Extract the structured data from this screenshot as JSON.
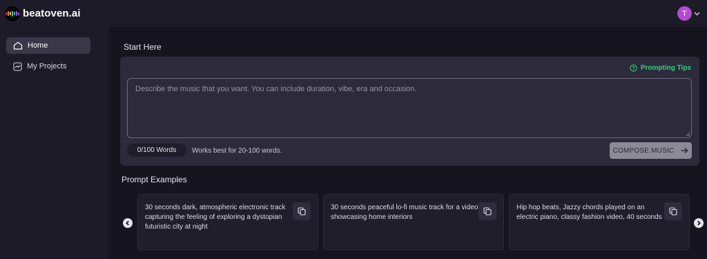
{
  "brand": {
    "name": "beatoven.ai"
  },
  "user": {
    "initial": "T",
    "avatar_color": "#b24bd1"
  },
  "sidebar": {
    "items": [
      {
        "label": "Home",
        "icon": "home-icon",
        "active": true
      },
      {
        "label": "My Projects",
        "icon": "chart-square-icon",
        "active": false
      }
    ]
  },
  "start": {
    "title": "Start Here",
    "tips_label": "Prompting Tips",
    "placeholder": "Describe the music that you want. You can include duration, vibe, era and occasion.",
    "value": "",
    "word_count": "0/100 Words",
    "hint": "Works best for 20-100 words.",
    "compose_label": "COMPOSE MUSIC"
  },
  "examples": {
    "title": "Prompt Examples",
    "cards": [
      {
        "text": "30 seconds dark, atmospheric electronic track capturing the feeling of exploring a dystopian futuristic city at night"
      },
      {
        "text": "30 seconds peaceful lo-fi music track for a video showcasing home interiors"
      },
      {
        "text": "Hip hop beats, Jazzy chords played on an electric piano, classy fashion video, 40 seconds"
      }
    ]
  },
  "colors": {
    "accent_green": "#2fd27a",
    "panel": "#2c2a3b",
    "background": "#16141f"
  }
}
